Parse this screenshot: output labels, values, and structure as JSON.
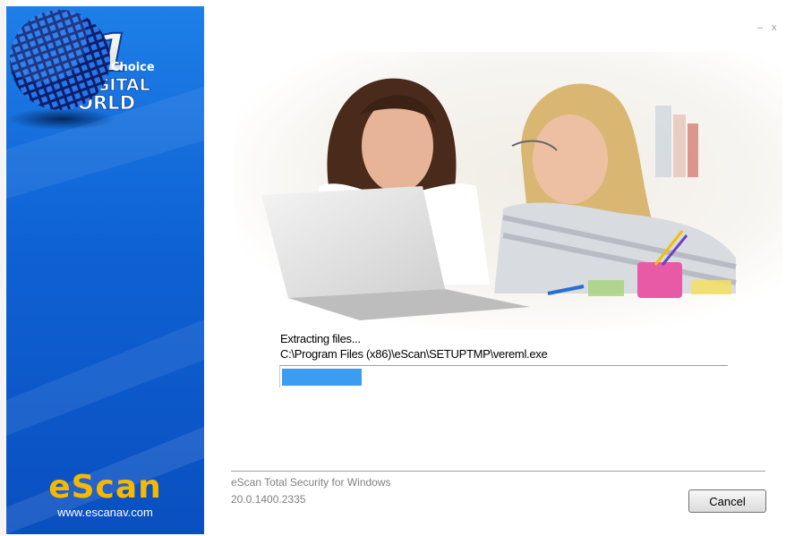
{
  "window": {
    "minimize_glyph": "–",
    "close_glyph": "x"
  },
  "sidebar": {
    "badge": {
      "rank": "#1",
      "line1": "Choice",
      "line2": "of DIGITAL",
      "line3": "WORLD"
    },
    "brand_name": "eScan",
    "brand_url": "www.escanav.com",
    "icons": [
      "badge-icon",
      "globe-icon",
      "escan-logo"
    ],
    "colors": {
      "background": "#0f62d4",
      "brand": "#f6b800"
    }
  },
  "install": {
    "status": "Extracting files...",
    "path": "C:\\Program Files (x86)\\eScan\\SETUPTMP\\vereml.exe",
    "progress": 0.18,
    "progress_color": "#3b9cf0"
  },
  "footer": {
    "product": "eScan Total Security for Windows",
    "version": "20.0.1400.2335",
    "cancel_label": "Cancel"
  }
}
